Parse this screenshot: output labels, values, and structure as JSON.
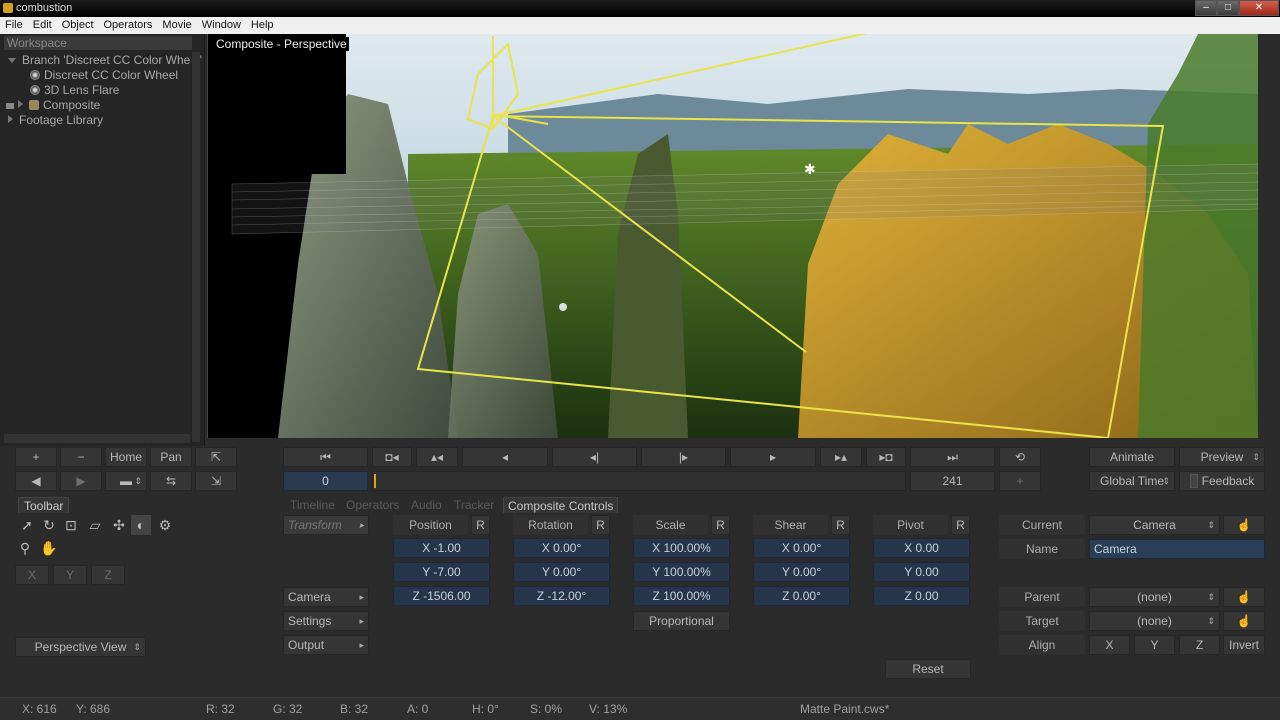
{
  "window": {
    "title": "combustion"
  },
  "menu": [
    "File",
    "Edit",
    "Object",
    "Operators",
    "Movie",
    "Window",
    "Help"
  ],
  "workspace": {
    "header": "Workspace",
    "items": [
      {
        "label": "Branch 'Discreet CC Color Wheel'"
      },
      {
        "label": "Discreet CC Color Wheel"
      },
      {
        "label": "3D Lens Flare"
      },
      {
        "label": "Composite"
      },
      {
        "label": "Footage Library"
      }
    ]
  },
  "viewport": {
    "label": "Composite - Perspective"
  },
  "view_controls": {
    "plus": "+",
    "minus": "−",
    "home": "Home",
    "pan": "Pan"
  },
  "transport": {
    "current_frame": "0",
    "end_frame": "241",
    "animate": "Animate",
    "preview": "Preview",
    "global_time": "Global Time",
    "feedback": "Feedback"
  },
  "toolbar": {
    "title": "Toolbar",
    "x": "X",
    "y": "Y",
    "z": "Z",
    "view_mode": "Perspective View"
  },
  "tabs": [
    "Timeline",
    "Operators",
    "Audio",
    "Tracker",
    "Composite Controls"
  ],
  "sections": {
    "transform": "Transform",
    "camera": "Camera",
    "settings": "Settings",
    "output": "Output"
  },
  "transform": {
    "reset_label": "R",
    "position": {
      "label": "Position",
      "x": "X -1.00",
      "y": "Y -7.00",
      "z": "Z -1506.00"
    },
    "rotation": {
      "label": "Rotation",
      "x": "X 0.00°",
      "y": "Y 0.00°",
      "z": "Z -12.00°"
    },
    "scale": {
      "label": "Scale",
      "x": "X 100.00%",
      "y": "Y 100.00%",
      "z": "Z 100.00%"
    },
    "shear": {
      "label": "Shear",
      "x": "X 0.00°",
      "y": "Y 0.00°",
      "z": "Z 0.00°"
    },
    "pivot": {
      "label": "Pivot",
      "x": "X 0.00",
      "y": "Y 0.00",
      "z": "Z 0.00"
    },
    "proportional": "Proportional",
    "reset": "Reset"
  },
  "camera_panel": {
    "current_label": "Current",
    "current_value": "Camera",
    "name_label": "Name",
    "name_value": "Camera",
    "parent_label": "Parent",
    "parent_value": "(none)",
    "target_label": "Target",
    "target_value": "(none)",
    "align_label": "Align",
    "align_x": "X",
    "align_y": "Y",
    "align_z": "Z",
    "invert": "Invert"
  },
  "status": {
    "x": "X:   616",
    "y": "Y:   686",
    "r": "R: 32",
    "g": "G: 32",
    "b": "B: 32",
    "a": "A: 0",
    "h": "H: 0°",
    "s": "S: 0%",
    "v": "V: 13%",
    "file": "Matte Paint.cws*"
  },
  "colors": {
    "field_bg": "#26354a",
    "wireframe": "#e6e24a",
    "panel": "#2b2b2b"
  }
}
